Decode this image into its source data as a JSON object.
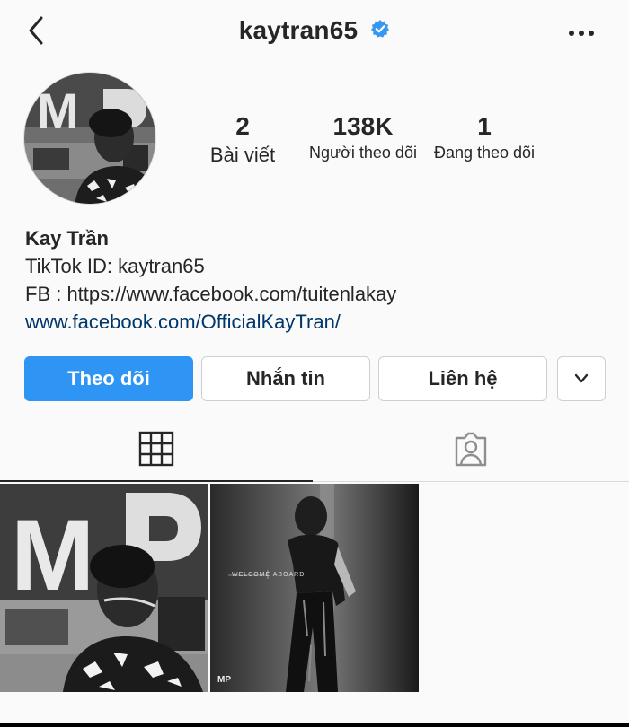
{
  "header": {
    "username": "kaytran65",
    "back_icon": "chevron-left-icon",
    "verified_icon": "verified-badge-icon",
    "more_icon": "more-horizontal-icon"
  },
  "stats": {
    "posts": {
      "value": "2",
      "label": "Bài viết"
    },
    "followers": {
      "value": "138K",
      "label": "Người theo dõi"
    },
    "following": {
      "value": "1",
      "label": "Đang theo dõi"
    }
  },
  "bio": {
    "name": "Kay Trần",
    "line1": "TikTok ID: kaytran65",
    "line2": "FB : https://www.facebook.com/tuitenlakay",
    "link": "www.facebook.com/OfficialKayTran/"
  },
  "actions": {
    "follow_label": "Theo dõi",
    "message_label": "Nhắn tin",
    "contact_label": "Liên hệ",
    "dropdown_icon": "chevron-down-icon"
  },
  "tabs": [
    {
      "icon": "grid-icon",
      "active": true
    },
    {
      "icon": "tagged-person-icon",
      "active": false
    }
  ],
  "posts": [
    {
      "caption": "",
      "mark": ""
    },
    {
      "caption": "WELCOME  ABOARD",
      "mark": "MP"
    }
  ],
  "colors": {
    "accent": "#2f95f5",
    "link": "#00376b",
    "verified": "#3797f0"
  }
}
